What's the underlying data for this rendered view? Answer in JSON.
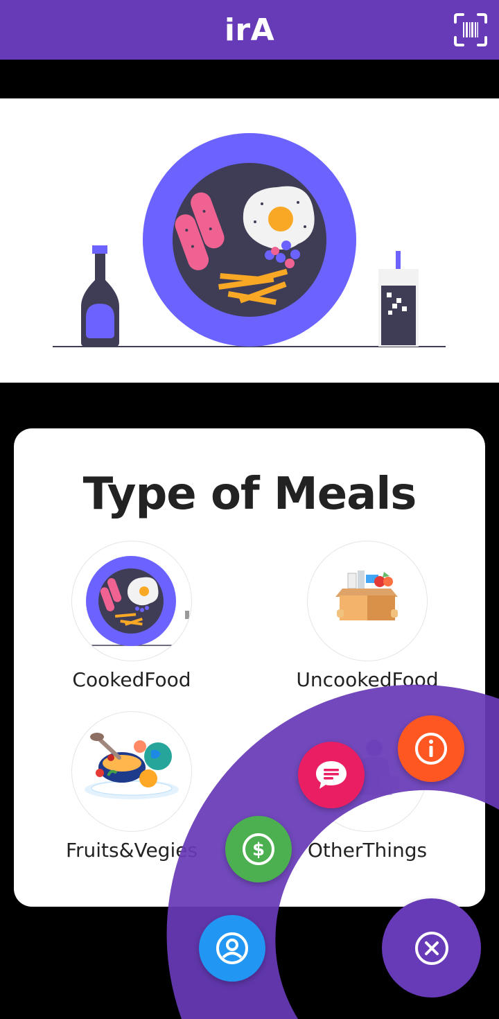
{
  "appbar": {
    "title": "irA",
    "scan_icon": "barcode-scan-icon"
  },
  "hero": {
    "illustration": "breakfast-plate-illustration"
  },
  "meals_card": {
    "heading": "Type of Meals",
    "items": [
      {
        "label": "CookedFood",
        "icon": "cooked-food-image"
      },
      {
        "label": "UncookedFood",
        "icon": "grocery-box-image"
      },
      {
        "label": "Fruits&Vegies",
        "icon": "fruits-vegies-image"
      },
      {
        "label": "OtherThings",
        "icon": "other-things-image"
      }
    ]
  },
  "fab_menu": {
    "items": [
      {
        "name": "profile",
        "icon": "account-circle-icon",
        "color": "#2196F3"
      },
      {
        "name": "money",
        "icon": "dollar-icon",
        "color": "#4CAF50"
      },
      {
        "name": "chat",
        "icon": "message-icon",
        "color": "#E91E63"
      },
      {
        "name": "info",
        "icon": "info-icon",
        "color": "#FF5722"
      }
    ],
    "close_icon": "close-circle-icon",
    "accent": "#673AB7"
  }
}
